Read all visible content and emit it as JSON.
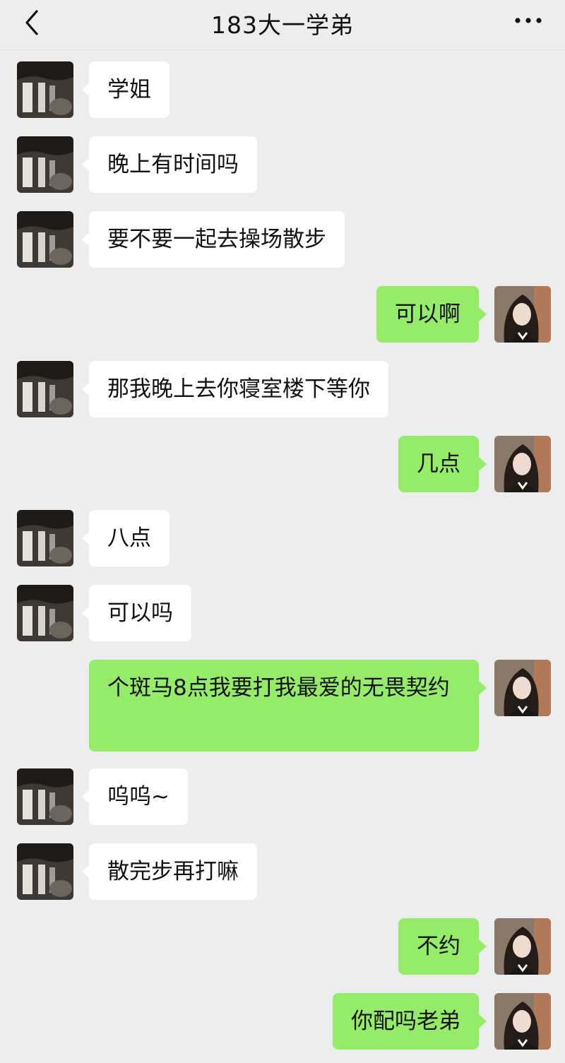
{
  "header": {
    "back_icon": "chevron-left-icon",
    "title": "183大一学弟",
    "more_icon": "ellipsis-icon"
  },
  "colors": {
    "background": "#ededed",
    "incoming_bubble": "#ffffff",
    "outgoing_bubble": "#95ec69"
  },
  "messages": [
    {
      "side": "left",
      "text": "学姐"
    },
    {
      "side": "left",
      "text": "晚上有时间吗"
    },
    {
      "side": "left",
      "text": "要不要一起去操场散步"
    },
    {
      "side": "right",
      "text": "可以啊"
    },
    {
      "side": "left",
      "text": "那我晚上去你寝室楼下等你"
    },
    {
      "side": "right",
      "text": "几点"
    },
    {
      "side": "left",
      "text": "八点"
    },
    {
      "side": "left",
      "text": "可以吗"
    },
    {
      "side": "right",
      "text": "个斑马8点我要打我最爱的无畏契约"
    },
    {
      "side": "left",
      "text": "呜呜~"
    },
    {
      "side": "left",
      "text": "散完步再打嘛"
    },
    {
      "side": "right",
      "text": "不约"
    },
    {
      "side": "right",
      "text": "你配吗老弟"
    }
  ]
}
